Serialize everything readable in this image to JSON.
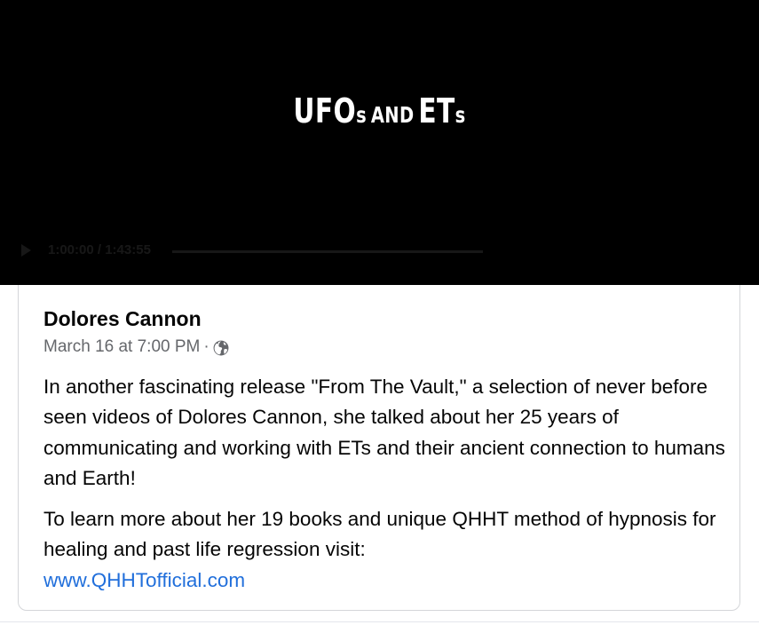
{
  "video": {
    "title_big_1": "UFO",
    "title_big_2": "s",
    "title_small": "AND",
    "title_big_3": "ET",
    "title_big_4": "s",
    "title_full": "UFOs and ETs",
    "faint_time": "1:00:00 / 1:43:55"
  },
  "post": {
    "author": "Dolores Cannon",
    "timestamp": "March 16 at 7:00 PM",
    "separator": "·",
    "privacy_icon": "globe-icon",
    "paragraph1": "In another fascinating release \"From The Vault,\" a selection of never before seen videos of Dolores Cannon, she talked about her 25 years of communicating and working with ETs and their ancient connection to humans and Earth!",
    "paragraph2": "To learn more about her 19 books and unique QHHT method of hypnosis for healing and past life regression visit:",
    "link_text": "www.QHHTofficial.com"
  },
  "colors": {
    "video_bg": "#000000",
    "text_primary": "#050505",
    "text_secondary": "#65676b",
    "link": "#216fdb",
    "card_border": "#d4d6d9"
  }
}
